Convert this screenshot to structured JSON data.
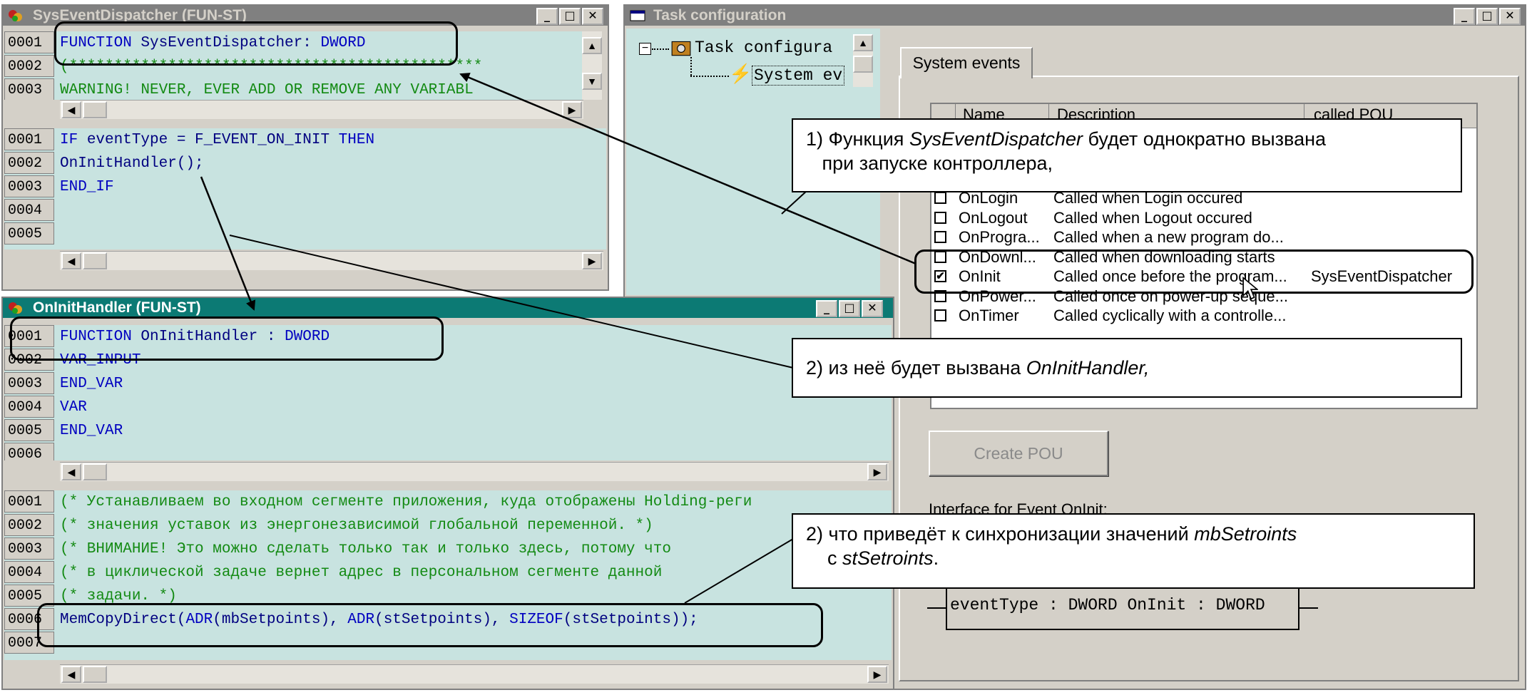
{
  "sysevent_window": {
    "title": "SysEventDispatcher (FUN-ST)",
    "decl_lines": [
      {
        "num": "0001",
        "parts": [
          {
            "t": "FUNCTION ",
            "c": "kw"
          },
          {
            "t": "SysEventDispatcher: ",
            "c": ""
          },
          {
            "t": "DWORD",
            "c": "kw"
          }
        ]
      },
      {
        "num": "0002",
        "parts": [
          {
            "t": "(**********************************************",
            "c": "cm"
          }
        ]
      },
      {
        "num": "0003",
        "parts": [
          {
            "t": "  WARNING! NEVER, EVER ADD OR REMOVE ANY VARIABL",
            "c": "cm"
          }
        ]
      }
    ],
    "body_lines": [
      {
        "num": "0001",
        "parts": [
          {
            "t": "IF ",
            "c": "kw"
          },
          {
            "t": "eventType = F_EVENT_ON_INIT ",
            "c": ""
          },
          {
            "t": "THEN",
            "c": "kw"
          }
        ]
      },
      {
        "num": "0002",
        "parts": [
          {
            "t": "  OnInitHandler();",
            "c": ""
          }
        ]
      },
      {
        "num": "0003",
        "parts": [
          {
            "t": "END_IF",
            "c": "kw"
          }
        ]
      },
      {
        "num": "0004",
        "parts": []
      },
      {
        "num": "0005",
        "parts": []
      }
    ]
  },
  "task_window": {
    "title": "Task configuration",
    "tree_root": "Task configura",
    "tree_child": "System ev",
    "tab_label": "System events",
    "columns": [
      "Name",
      "Description",
      "called POU"
    ],
    "events": [
      {
        "checked": false,
        "name": "OnLogin",
        "desc": "Called when Login occured",
        "pou": ""
      },
      {
        "checked": false,
        "name": "OnLogout",
        "desc": "Called when Logout occured",
        "pou": ""
      },
      {
        "checked": false,
        "name": "OnProgra...",
        "desc": "Called when a new program do...",
        "pou": ""
      },
      {
        "checked": false,
        "name": "OnDownl...",
        "desc": "Called when downloading starts",
        "pou": ""
      },
      {
        "checked": true,
        "name": "OnInit",
        "desc": "Called once before the program...",
        "pou": "SysEventDispatcher"
      },
      {
        "checked": false,
        "name": "OnPower...",
        "desc": "Called once on power-up seque...",
        "pou": ""
      },
      {
        "checked": false,
        "name": "OnTimer",
        "desc": "Called cyclically with a controlle...",
        "pou": ""
      }
    ],
    "create_pou_label": "Create POU",
    "interface_label": "Interface for Event OnInit:",
    "interface_signature": "eventType : DWORD OnInit : DWORD"
  },
  "oninit_window": {
    "title": "OnInitHandler (FUN-ST)",
    "decl_lines": [
      {
        "num": "0001",
        "parts": [
          {
            "t": "FUNCTION ",
            "c": "kw"
          },
          {
            "t": "OnInitHandler : ",
            "c": ""
          },
          {
            "t": "DWORD",
            "c": "kw"
          }
        ]
      },
      {
        "num": "0002",
        "parts": [
          {
            "t": "VAR_INPUT",
            "c": "kw"
          }
        ]
      },
      {
        "num": "0003",
        "parts": [
          {
            "t": "END_VAR",
            "c": "kw"
          }
        ]
      },
      {
        "num": "0004",
        "parts": [
          {
            "t": "VAR",
            "c": "kw"
          }
        ]
      },
      {
        "num": "0005",
        "parts": [
          {
            "t": "END_VAR",
            "c": "kw"
          }
        ]
      },
      {
        "num": "0006",
        "parts": []
      }
    ],
    "body_lines": [
      {
        "num": "0001",
        "parts": [
          {
            "t": "(* Устанавливаем во входном сегменте приложения, куда отображены Holding-реги",
            "c": "cm"
          }
        ]
      },
      {
        "num": "0002",
        "parts": [
          {
            "t": "(* значения уставок из энергонезависимой глобальной переменной. *)",
            "c": "cm"
          }
        ]
      },
      {
        "num": "0003",
        "parts": [
          {
            "t": "(* ВНИМАНИЕ! Это можно сделать только так и только здесь, потому что",
            "c": "cm"
          }
        ]
      },
      {
        "num": "0004",
        "parts": [
          {
            "t": "(* в циклической задаче вернет адрес в персональном сегменте данной",
            "c": "cm"
          }
        ]
      },
      {
        "num": "0005",
        "parts": [
          {
            "t": "(* задачи. *)",
            "c": "cm"
          }
        ]
      },
      {
        "num": "0006",
        "parts": [
          {
            "t": "MemCopyDirect(",
            "c": ""
          },
          {
            "t": "ADR",
            "c": "kw"
          },
          {
            "t": "(mbSetpoints), ",
            "c": ""
          },
          {
            "t": "ADR",
            "c": "kw"
          },
          {
            "t": "(stSetpoints), ",
            "c": ""
          },
          {
            "t": "SIZEOF",
            "c": "kw"
          },
          {
            "t": "(stSetpoints));",
            "c": ""
          }
        ]
      },
      {
        "num": "0007",
        "parts": []
      }
    ]
  },
  "callouts": {
    "c1_prefix": "1) Функция ",
    "c1_italic": "SysEventDispatcher",
    "c1_suffix": " будет однократно вызвана",
    "c1_line2": "при запуске контроллера,",
    "c2_prefix": "2) из неё будет вызвана ",
    "c2_italic": "OnInitHandler,",
    "c3_prefix": "2) что приведёт к синхронизации значений ",
    "c3_italic1": "mbSetroints",
    "c3_line2_prefix": "с ",
    "c3_italic2": "stSetroints",
    "c3_line2_suffix": "."
  },
  "colors": {
    "code_bg": "#c8e3e0",
    "active_title": "#0c7a74",
    "inactive_title": "#808080",
    "keyword": "#0000c0",
    "comment": "#138a13"
  }
}
